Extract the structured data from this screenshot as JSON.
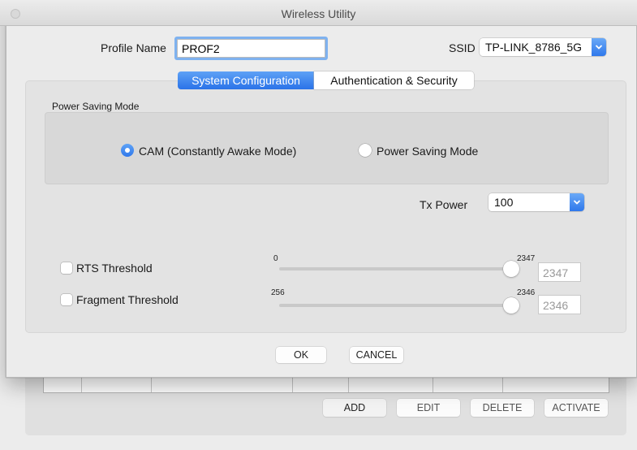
{
  "window": {
    "title": "Wireless Utility"
  },
  "profile": {
    "label": "Profile Name",
    "value": "PROF2"
  },
  "ssid": {
    "label": "SSID",
    "value": "TP-LINK_8786_5G"
  },
  "tabs": [
    {
      "label": "System Configuration",
      "selected": true
    },
    {
      "label": "Authentication & Security",
      "selected": false
    }
  ],
  "power_saving": {
    "group_label": "Power Saving Mode",
    "options": [
      {
        "label": "CAM (Constantly Awake Mode)",
        "selected": true
      },
      {
        "label": "Power Saving Mode",
        "selected": false
      }
    ]
  },
  "tx_power": {
    "label": "Tx Power",
    "value": "100"
  },
  "rts": {
    "label": "RTS Threshold",
    "checked": false,
    "min_label": "0",
    "max_label": "2347",
    "value": "2347"
  },
  "fragment": {
    "label": "Fragment Threshold",
    "checked": false,
    "min_label": "256",
    "max_label": "2346",
    "value": "2346"
  },
  "dialog_buttons": {
    "ok": "OK",
    "cancel": "CANCEL"
  },
  "background_buttons": {
    "add": "ADD",
    "edit": "EDIT",
    "delete": "DELETE",
    "activate": "ACTIVATE"
  },
  "colors": {
    "accent": "#2f78eb",
    "focus_ring": "#7fb2ef"
  }
}
